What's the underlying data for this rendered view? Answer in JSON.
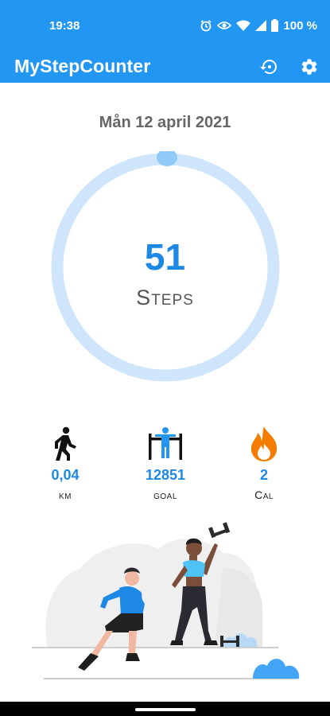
{
  "status_bar": {
    "time": "19:38",
    "battery": "100 %",
    "icons": [
      "alarm-icon",
      "eye-icon",
      "wifi-icon",
      "signal-icon",
      "battery-icon"
    ]
  },
  "app_bar": {
    "title": "MyStepCounter",
    "icons": [
      "history-icon",
      "settings-gear-icon"
    ],
    "color": "#2196f3"
  },
  "main": {
    "date": "Mån 12 april 2021",
    "steps_value": "51",
    "steps_label": "Steps",
    "ring_track_color": "#cfe5fb",
    "ring_knob_color": "#90caf9",
    "value_color": "#1e88e5"
  },
  "stats": [
    {
      "icon": "walking-person-icon",
      "value": "0,04",
      "label": "km"
    },
    {
      "icon": "goal-finish-line-icon",
      "value": "12851",
      "label": "goal"
    },
    {
      "icon": "flame-icon",
      "value": "2",
      "label": "Cal"
    }
  ]
}
